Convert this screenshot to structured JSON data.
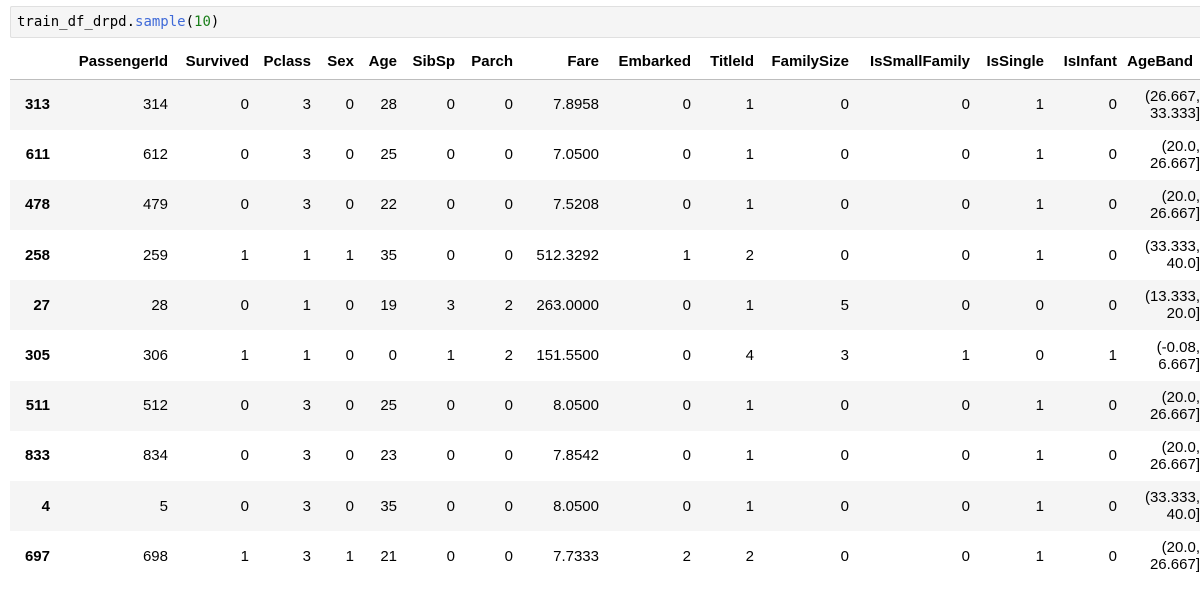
{
  "cell": {
    "code_object": "train_df_drpd",
    "code_dot": ".",
    "code_method": "sample",
    "code_open": "(",
    "code_arg": "10",
    "code_close": ")"
  },
  "table": {
    "columns": [
      "",
      "PassengerId",
      "Survived",
      "Pclass",
      "Sex",
      "Age",
      "SibSp",
      "Parch",
      "Fare",
      "Embarked",
      "TitleId",
      "FamilySize",
      "IsSmallFamily",
      "IsSingle",
      "IsInfant",
      "AgeBand"
    ],
    "rows": [
      [
        "313",
        "314",
        "0",
        "3",
        "0",
        "28",
        "0",
        "0",
        "7.8958",
        "0",
        "1",
        "0",
        "0",
        "1",
        "0",
        "(26.667, 33.333]"
      ],
      [
        "611",
        "612",
        "0",
        "3",
        "0",
        "25",
        "0",
        "0",
        "7.0500",
        "0",
        "1",
        "0",
        "0",
        "1",
        "0",
        "(20.0, 26.667]"
      ],
      [
        "478",
        "479",
        "0",
        "3",
        "0",
        "22",
        "0",
        "0",
        "7.5208",
        "0",
        "1",
        "0",
        "0",
        "1",
        "0",
        "(20.0, 26.667]"
      ],
      [
        "258",
        "259",
        "1",
        "1",
        "1",
        "35",
        "0",
        "0",
        "512.3292",
        "1",
        "2",
        "0",
        "0",
        "1",
        "0",
        "(33.333, 40.0]"
      ],
      [
        "27",
        "28",
        "0",
        "1",
        "0",
        "19",
        "3",
        "2",
        "263.0000",
        "0",
        "1",
        "5",
        "0",
        "0",
        "0",
        "(13.333, 20.0]"
      ],
      [
        "305",
        "306",
        "1",
        "1",
        "0",
        "0",
        "1",
        "2",
        "151.5500",
        "0",
        "4",
        "3",
        "1",
        "0",
        "1",
        "(-0.08, 6.667]"
      ],
      [
        "511",
        "512",
        "0",
        "3",
        "0",
        "25",
        "0",
        "0",
        "8.0500",
        "0",
        "1",
        "0",
        "0",
        "1",
        "0",
        "(20.0, 26.667]"
      ],
      [
        "833",
        "834",
        "0",
        "3",
        "0",
        "23",
        "0",
        "0",
        "7.8542",
        "0",
        "1",
        "0",
        "0",
        "1",
        "0",
        "(20.0, 26.667]"
      ],
      [
        "4",
        "5",
        "0",
        "3",
        "0",
        "35",
        "0",
        "0",
        "8.0500",
        "0",
        "1",
        "0",
        "0",
        "1",
        "0",
        "(33.333, 40.0]"
      ],
      [
        "697",
        "698",
        "1",
        "3",
        "1",
        "21",
        "0",
        "0",
        "7.7333",
        "2",
        "2",
        "0",
        "0",
        "1",
        "0",
        "(20.0, 26.667]"
      ]
    ]
  },
  "colors": {
    "cell_background": "#f5f5f5",
    "method_color": "#3f6ad8",
    "number_color": "#1a7f1a",
    "stripe": "#f5f5f5"
  }
}
